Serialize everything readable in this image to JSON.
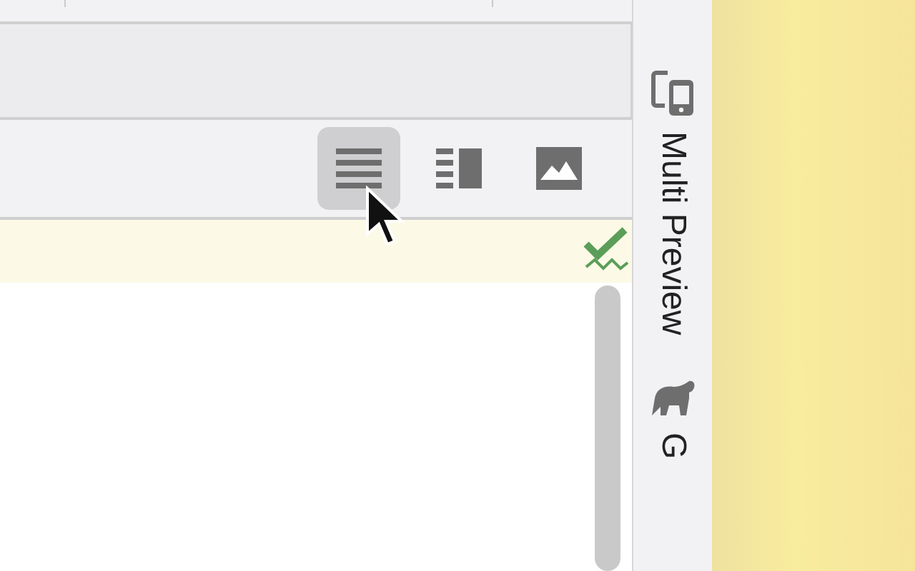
{
  "view_modes": [
    {
      "kind": "code",
      "selected": true
    },
    {
      "kind": "split",
      "selected": false
    },
    {
      "kind": "design",
      "selected": false
    }
  ],
  "tool_windows": [
    {
      "kind": "devices",
      "label": "Multi Preview"
    },
    {
      "kind": "elephant",
      "label": "G"
    }
  ]
}
